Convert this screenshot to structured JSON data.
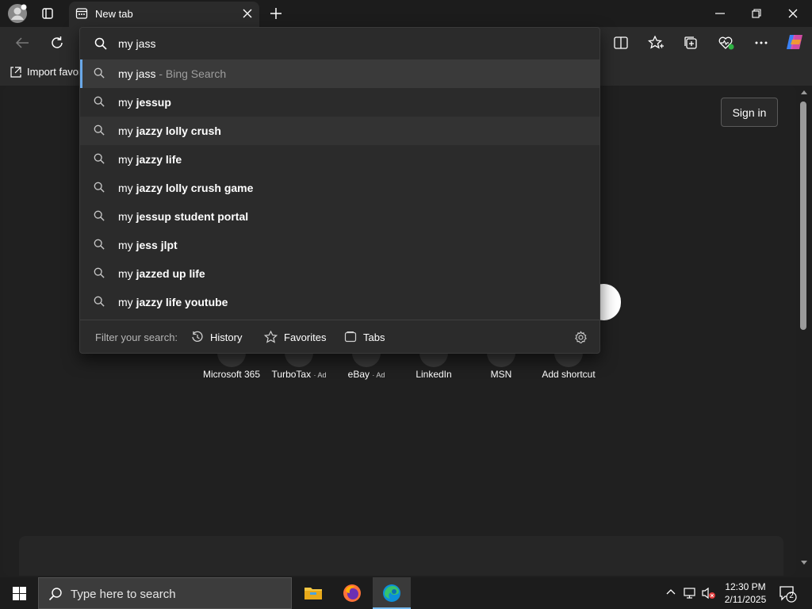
{
  "tab": {
    "title": "New tab"
  },
  "favorites_bar": {
    "import_label": "Import favor"
  },
  "page": {
    "sign_in": "Sign in"
  },
  "shortcuts": [
    {
      "label": "Microsoft 365",
      "ad": ""
    },
    {
      "label": "TurboTax",
      "ad": "· Ad"
    },
    {
      "label": "eBay",
      "ad": "· Ad"
    },
    {
      "label": "LinkedIn",
      "ad": ""
    },
    {
      "label": "MSN",
      "ad": ""
    },
    {
      "label": "Add shortcut",
      "ad": ""
    }
  ],
  "address_dropdown": {
    "query": "my jass",
    "first": {
      "text": "my jass",
      "suffix": " - Bing Search"
    },
    "suggestions": [
      {
        "prefix": "my ",
        "bold": "jessup"
      },
      {
        "prefix": "my ",
        "bold": "jazzy lolly crush"
      },
      {
        "prefix": "my ",
        "bold": "jazzy life"
      },
      {
        "prefix": "my ",
        "bold": "jazzy lolly crush game"
      },
      {
        "prefix": "my ",
        "bold": "jessup student portal"
      },
      {
        "prefix": "my ",
        "bold": "jess jlpt"
      },
      {
        "prefix": "my ",
        "bold": "jazzed up life"
      },
      {
        "prefix": "my ",
        "bold": "jazzy life youtube"
      }
    ],
    "filter": {
      "label": "Filter your search:",
      "history": "History",
      "favorites": "Favorites",
      "tabs": "Tabs"
    }
  },
  "taskbar": {
    "search_placeholder": "Type here to search",
    "time": "12:30 PM",
    "date": "2/11/2025",
    "notification_count": "2"
  }
}
